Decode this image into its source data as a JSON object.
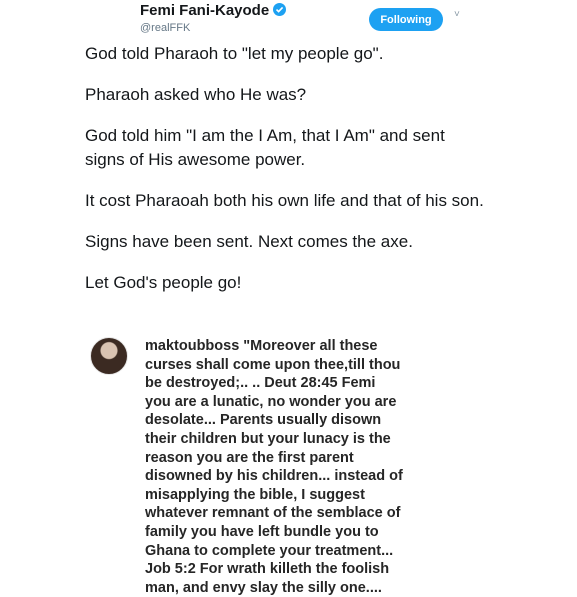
{
  "header": {
    "display_name": "Femi Fani-Kayode",
    "handle": "@realFFK",
    "follow_label": "Following",
    "caret": "˅"
  },
  "tweet": {
    "lines": [
      "God told Pharaoh to \"let my people go\".",
      "Pharaoh asked who He was?",
      "God told him \"I am the I Am, that I Am\" and sent signs of His awesome power.",
      "It cost Pharaoah both his own life and that of his son.",
      "Signs have been sent. Next comes the axe.",
      "Let God's people go!"
    ]
  },
  "comment": {
    "username": "maktoubboss",
    "text": "\"Moreover all these curses shall come upon thee,till thou be destroyed;.. .. Deut 28:45 Femi you are a lunatic, no wonder you are desolate... Parents usually disown their children but your lunacy is the reason you are the first parent disowned by his children... instead of misapplying the bible, I suggest whatever remnant of the semblace of family you have left bundle you to Ghana to complete your treatment... Job 5:2 For wrath killeth the foolish man, and envy slay the silly one...."
  },
  "colors": {
    "accent": "#1da1f2",
    "handle": "#657786",
    "text": "#14171a"
  }
}
